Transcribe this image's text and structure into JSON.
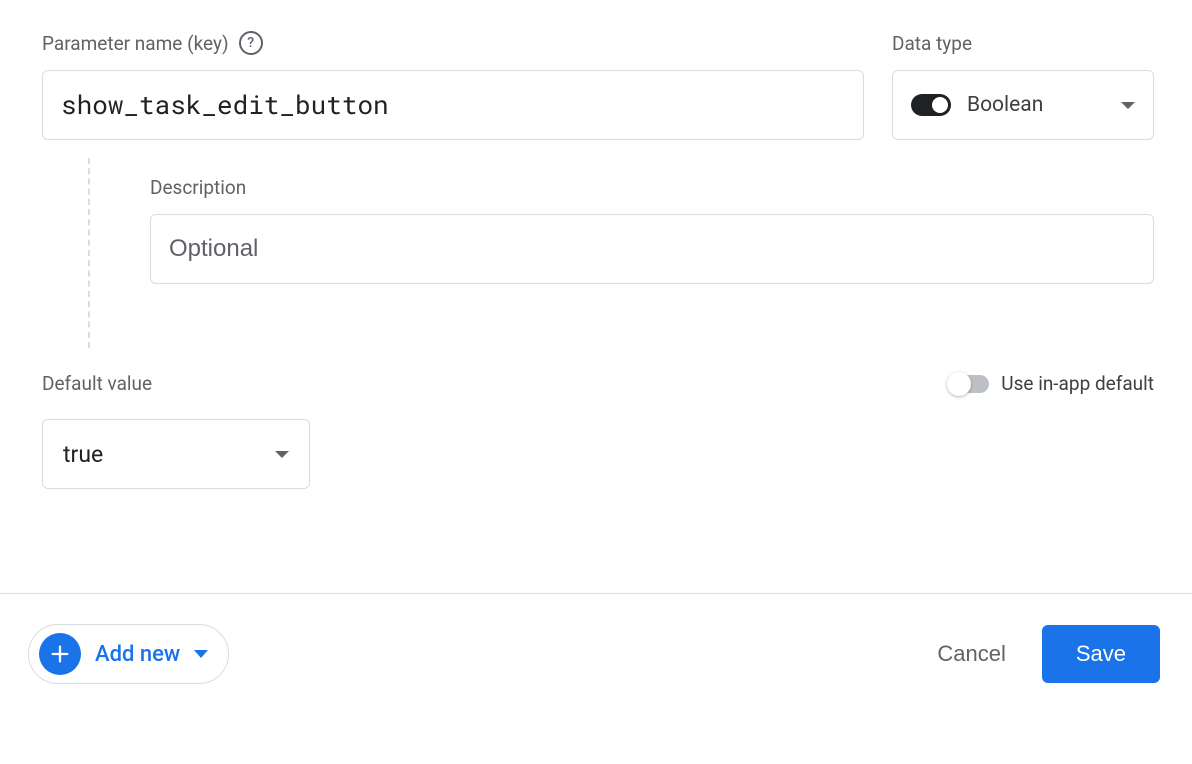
{
  "parameter": {
    "name_label": "Parameter name (key)",
    "name_value": "show_task_edit_button"
  },
  "datatype": {
    "label": "Data type",
    "value": "Boolean"
  },
  "description": {
    "label": "Description",
    "placeholder": "Optional",
    "value": ""
  },
  "default": {
    "label": "Default value",
    "value": "true",
    "in_app_label": "Use in-app default"
  },
  "footer": {
    "add_new": "Add new",
    "cancel": "Cancel",
    "save": "Save"
  }
}
